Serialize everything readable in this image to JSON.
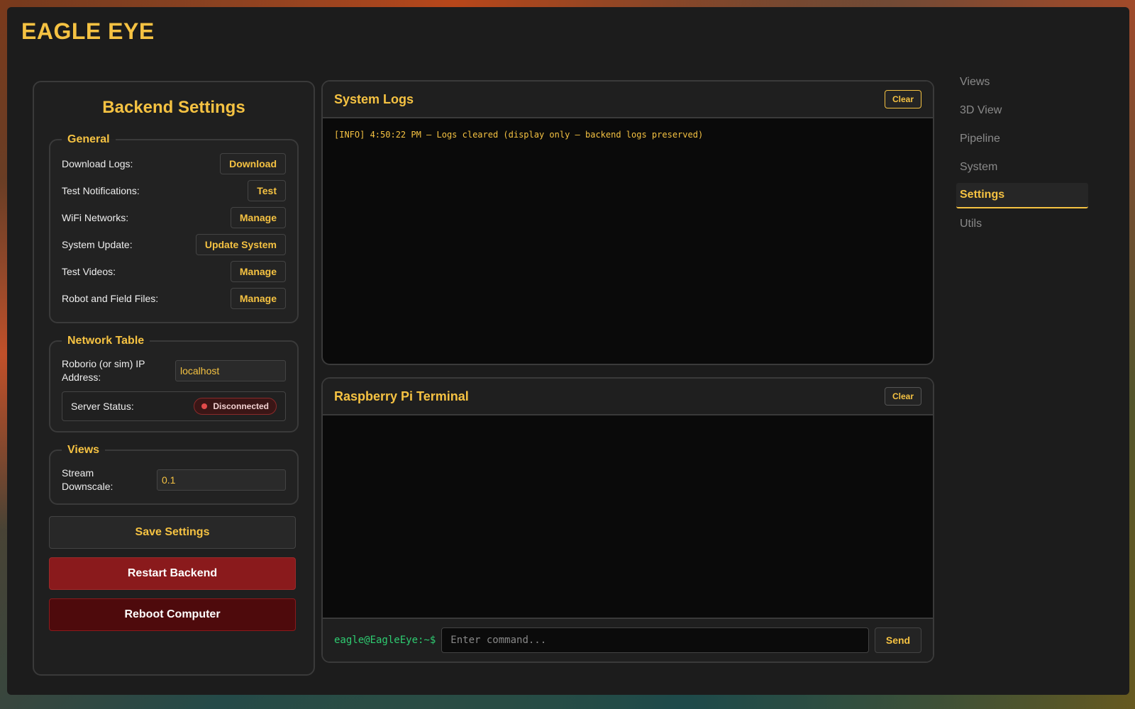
{
  "app": {
    "title": "EAGLE EYE"
  },
  "settings": {
    "title": "Backend Settings",
    "general": {
      "legend": "General",
      "rows": [
        {
          "label": "Download Logs:",
          "button": "Download"
        },
        {
          "label": "Test Notifications:",
          "button": "Test"
        },
        {
          "label": "WiFi Networks:",
          "button": "Manage"
        },
        {
          "label": "System Update:",
          "button": "Update System"
        },
        {
          "label": "Test Videos:",
          "button": "Manage"
        },
        {
          "label": "Robot and Field Files:",
          "button": "Manage"
        }
      ]
    },
    "network_table": {
      "legend": "Network Table",
      "ip_label_line1": "Roborio (or sim) IP",
      "ip_label_line2": "Address:",
      "ip_value": "localhost",
      "status_label": "Server Status:",
      "status_value": "Disconnected"
    },
    "views": {
      "legend": "Views",
      "downscale_label_line1": "Stream",
      "downscale_label_line2": "Downscale:",
      "downscale_value": "0.1"
    },
    "save_label": "Save Settings",
    "restart_label": "Restart Backend",
    "reboot_label": "Reboot Computer"
  },
  "logs": {
    "title": "System Logs",
    "clear_label": "Clear",
    "lines": [
      "[INFO] 4:50:22 PM – Logs cleared (display only – backend logs preserved)"
    ]
  },
  "terminal": {
    "title": "Raspberry Pi Terminal",
    "clear_label": "Clear",
    "prompt": "eagle@EagleEye:~$",
    "placeholder": "Enter command...",
    "send_label": "Send"
  },
  "nav": {
    "items": [
      "Views",
      "3D View",
      "Pipeline",
      "System",
      "Settings",
      "Utils"
    ],
    "active": "Settings"
  },
  "colors": {
    "accent": "#f5c242",
    "danger": "#8a1a1c",
    "prompt": "#2ecc71"
  }
}
